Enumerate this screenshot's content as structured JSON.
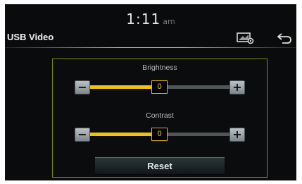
{
  "status_bar": {
    "time": "1:11",
    "ampm": "am"
  },
  "header": {
    "title": "USB Video",
    "settings_icon": "display-settings-icon",
    "back_icon": "back-arrow-icon"
  },
  "brightness": {
    "label": "Brightness",
    "value": "0",
    "decrease_label": "−",
    "increase_label": "+",
    "level": 0.5
  },
  "contrast": {
    "label": "Contrast",
    "value": "0",
    "decrease_label": "−",
    "increase_label": "+",
    "level": 0.5
  },
  "reset": {
    "label": "Reset"
  },
  "colors": {
    "accent": "#f0c30a",
    "panel_border": "#7d8b1a",
    "track": "#505658",
    "background": "#0a0b0c"
  }
}
